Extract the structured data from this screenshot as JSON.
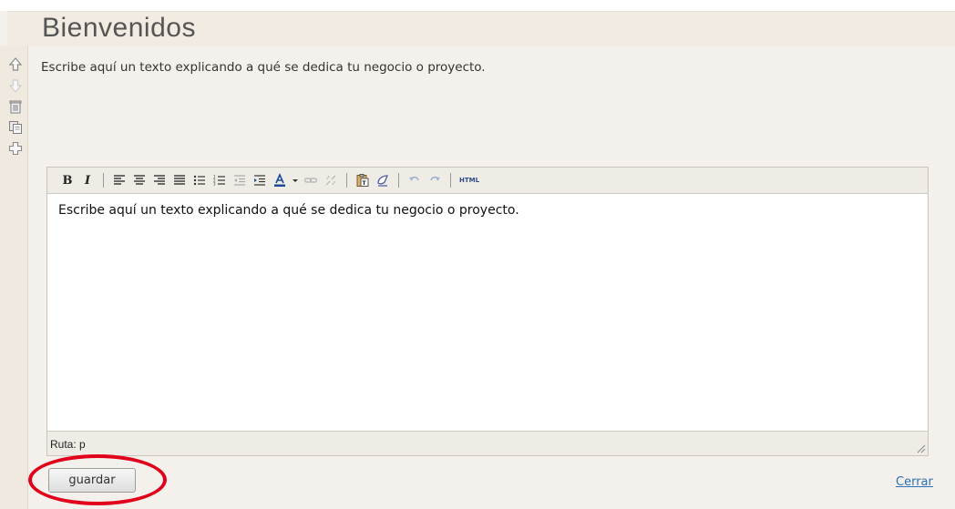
{
  "page": {
    "title": "Bienvenidos",
    "preview_text": "Escribe aquí un texto explicando a qué se dedica tu negocio o proyecto."
  },
  "side_tools": [
    {
      "name": "move-up-icon"
    },
    {
      "name": "move-down-icon"
    },
    {
      "name": "trash-icon"
    },
    {
      "name": "copy-icon"
    },
    {
      "name": "add-icon"
    }
  ],
  "toolbar": {
    "bold_label": "B",
    "italic_label": "I",
    "html_label": "HTML",
    "icons": [
      "align-left-icon",
      "align-center-icon",
      "align-right-icon",
      "align-justify-icon",
      "bullet-list-icon",
      "numbered-list-icon",
      "outdent-icon",
      "indent-icon",
      "font-color-icon",
      "link-icon",
      "unlink-icon",
      "paste-text-icon",
      "eraser-icon",
      "undo-icon",
      "redo-icon"
    ]
  },
  "editor": {
    "content": "Escribe aquí un texto explicando a qué se dedica tu negocio o proyecto.",
    "path_label": "Ruta: p"
  },
  "actions": {
    "save_label": "guardar",
    "close_label": "Cerrar"
  },
  "colors": {
    "highlight": "#e1001a",
    "link": "#2a6fb8"
  }
}
